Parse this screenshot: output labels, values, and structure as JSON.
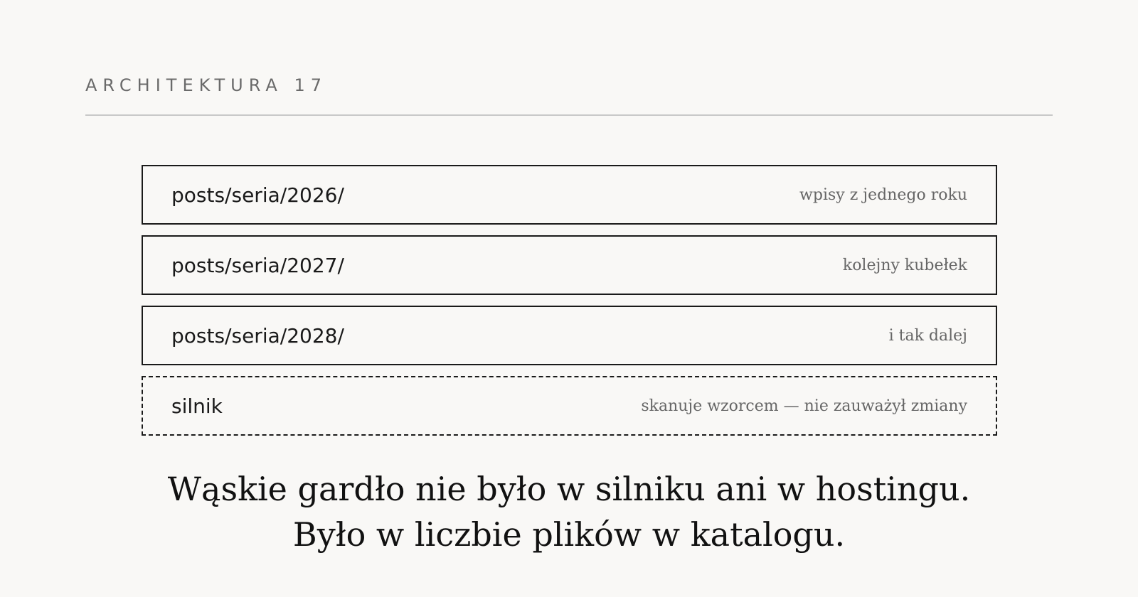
{
  "header": {
    "kicker": "ARCHITEKTURA 17"
  },
  "rows": [
    {
      "path": "posts/seria/2026/",
      "note": "wpisy z jednego roku"
    },
    {
      "path": "posts/seria/2027/",
      "note": "kolejny kubełek"
    },
    {
      "path": "posts/seria/2028/",
      "note": "i tak dalej"
    },
    {
      "path": "silnik",
      "note": "skanuje wzorcem — nie zauważył zmiany"
    }
  ],
  "headline": {
    "line1": "Wąskie gardło nie było w silniku ani w hostingu.",
    "line2": "Było w liczbie plików w katalogu."
  }
}
